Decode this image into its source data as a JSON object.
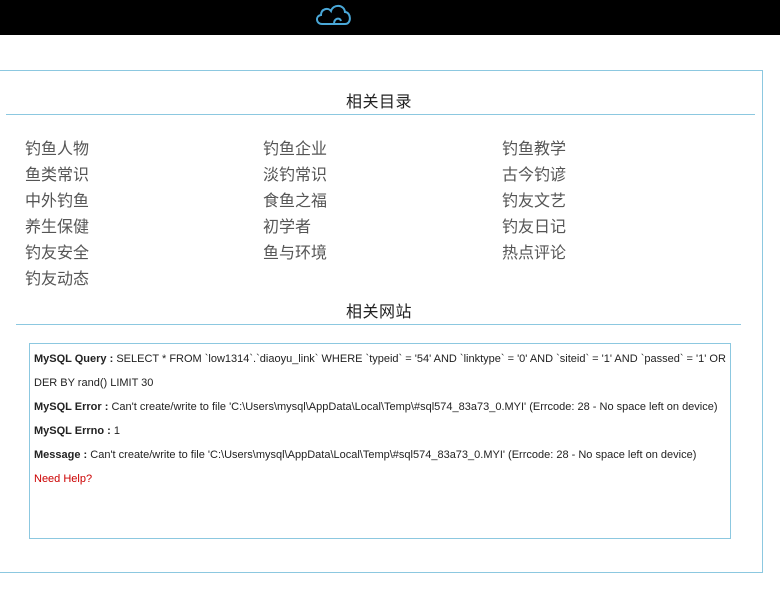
{
  "header": {
    "logo_icon": "cloud-icon",
    "accent": "#4aa8d8"
  },
  "related_dirs": {
    "title": "相关目录",
    "columns": [
      [
        "钓鱼人物",
        "鱼类常识",
        "中外钓鱼",
        "养生保健",
        "钓友安全",
        "钓友动态"
      ],
      [
        "钓鱼企业",
        "淡钓常识",
        "食鱼之福",
        "初学者",
        "鱼与环境"
      ],
      [
        "钓鱼教学",
        "古今钓谚",
        "钓友文艺",
        "钓友日记",
        "热点评论"
      ]
    ]
  },
  "related_sites": {
    "title": "相关网站"
  },
  "error": {
    "query_label": "MySQL Query :",
    "query_value": "SELECT * FROM `low1314`.`diaoyu_link` WHERE `typeid` = '54' AND `linktype` = '0' AND `siteid` = '1' AND `passed` = '1' ORDER BY rand() LIMIT 30",
    "error_label": "MySQL Error :",
    "error_value": "Can't create/write to file 'C:\\Users\\mysql\\AppData\\Local\\Temp\\#sql574_83a73_0.MYI' (Errcode: 28 - No space left on device)",
    "errno_label": "MySQL Errno :",
    "errno_value": "1",
    "message_label": "Message :",
    "message_value": "Can't create/write to file 'C:\\Users\\mysql\\AppData\\Local\\Temp\\#sql574_83a73_0.MYI' (Errcode: 28 - No space left on device)",
    "help_link": "Need Help?"
  },
  "colors": {
    "border": "#8cc8e0",
    "help": "#cc0000"
  }
}
